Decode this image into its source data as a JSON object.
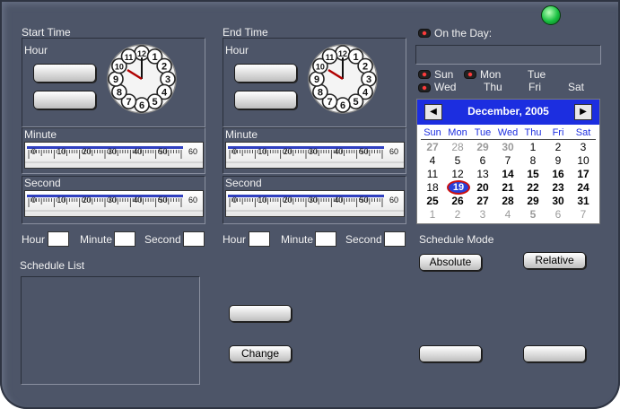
{
  "colors": {
    "window_bg": "#4d5568",
    "calendar_header": "#1c2ee0",
    "led_on": "#00c040",
    "today_ring": "#cc1010"
  },
  "start": {
    "title": "Start Time",
    "hour_label": "Hour",
    "minute_label": "Minute",
    "second_label": "Second",
    "field_hour": "Hour",
    "field_minute": "Minute",
    "field_second": "Second"
  },
  "end": {
    "title": "End Time",
    "hour_label": "Hour",
    "minute_label": "Minute",
    "second_label": "Second",
    "field_hour": "Hour",
    "field_minute": "Minute",
    "field_second": "Second"
  },
  "ruler_ticks": [
    "0",
    "10",
    "20",
    "30",
    "40",
    "50",
    "60"
  ],
  "clock_numbers": [
    "12",
    "1",
    "2",
    "3",
    "4",
    "5",
    "6",
    "7",
    "8",
    "9",
    "10",
    "11"
  ],
  "on_the_day": "On the Day:",
  "weekdays": {
    "sun": "Sun",
    "mon": "Mon",
    "tue": "Tue",
    "wed": "Wed",
    "thu": "Thu",
    "fri": "Fri",
    "sat": "Sat"
  },
  "calendar": {
    "month_title": "December, 2005",
    "prev": "◀",
    "next": "▶",
    "dow": [
      "Sun",
      "Mon",
      "Tue",
      "Wed",
      "Thu",
      "Fri",
      "Sat"
    ],
    "weeks": [
      [
        {
          "d": "27",
          "s": "gray bold"
        },
        {
          "d": "28",
          "s": "gray"
        },
        {
          "d": "29",
          "s": "gray bold"
        },
        {
          "d": "30",
          "s": "gray bold"
        },
        {
          "d": "1",
          "s": ""
        },
        {
          "d": "2",
          "s": ""
        },
        {
          "d": "3",
          "s": ""
        }
      ],
      [
        {
          "d": "4",
          "s": ""
        },
        {
          "d": "5",
          "s": ""
        },
        {
          "d": "6",
          "s": ""
        },
        {
          "d": "7",
          "s": ""
        },
        {
          "d": "8",
          "s": ""
        },
        {
          "d": "9",
          "s": ""
        },
        {
          "d": "10",
          "s": ""
        }
      ],
      [
        {
          "d": "11",
          "s": ""
        },
        {
          "d": "12",
          "s": ""
        },
        {
          "d": "13",
          "s": ""
        },
        {
          "d": "14",
          "s": "bold"
        },
        {
          "d": "15",
          "s": "bold"
        },
        {
          "d": "16",
          "s": "bold"
        },
        {
          "d": "17",
          "s": "bold"
        }
      ],
      [
        {
          "d": "18",
          "s": ""
        },
        {
          "d": "19",
          "s": "today"
        },
        {
          "d": "20",
          "s": "bold"
        },
        {
          "d": "21",
          "s": "bold"
        },
        {
          "d": "22",
          "s": "bold"
        },
        {
          "d": "23",
          "s": "bold"
        },
        {
          "d": "24",
          "s": "bold"
        }
      ],
      [
        {
          "d": "25",
          "s": "bold"
        },
        {
          "d": "26",
          "s": "bold"
        },
        {
          "d": "27",
          "s": "bold"
        },
        {
          "d": "28",
          "s": "bold"
        },
        {
          "d": "29",
          "s": "bold"
        },
        {
          "d": "30",
          "s": "bold"
        },
        {
          "d": "31",
          "s": "bold"
        }
      ],
      [
        {
          "d": "1",
          "s": "gray"
        },
        {
          "d": "2",
          "s": "gray"
        },
        {
          "d": "3",
          "s": "gray"
        },
        {
          "d": "4",
          "s": "gray"
        },
        {
          "d": "5",
          "s": "gray bold"
        },
        {
          "d": "6",
          "s": "gray"
        },
        {
          "d": "7",
          "s": "gray"
        }
      ]
    ]
  },
  "schedule_mode": "Schedule Mode",
  "schedule_list": "Schedule List",
  "buttons": {
    "absolute": "Absolute",
    "relative": "Relative",
    "change": "Change"
  }
}
